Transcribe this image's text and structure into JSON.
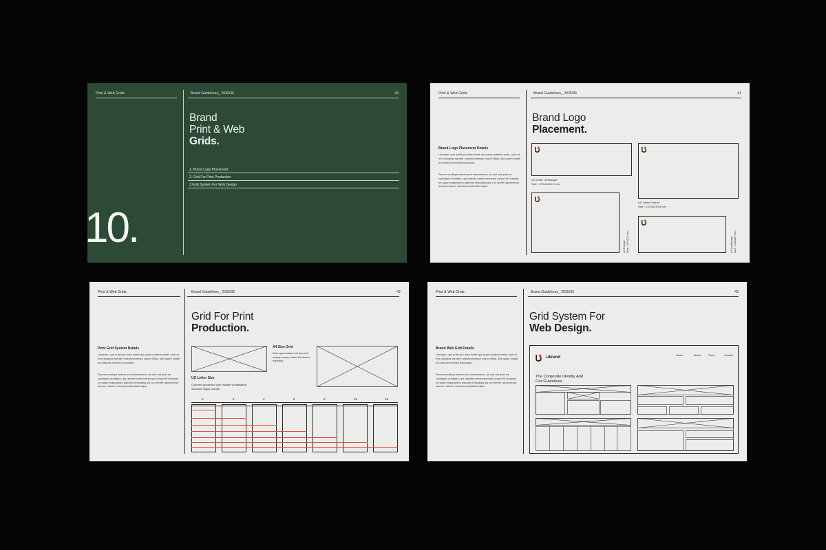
{
  "common": {
    "left_header": "Print & Web Grids.",
    "mid_header": "Brand Guidelines_ 2035/36"
  },
  "slides": [
    {
      "page": "40",
      "title_lines": [
        "Brand",
        "Print & Web"
      ],
      "title_bold": "Grids.",
      "toc": [
        "1. Brand Logo Placement",
        "2. Grid For Print Production",
        "3.Grid System For Web Design"
      ],
      "section_number": "10."
    },
    {
      "page": "41",
      "title_line": "Brand Logo",
      "title_bold": "Placement.",
      "side_title": "Brand Logo Placement Details",
      "para1": "Libusam, que autet qui mise deles qui quam autature essit, num et ees doluptas reprate volesmoemequi corpor illitus, sita quam iniatib no restrum evenihil exceaturn.",
      "para2": "Reonm molliupt miame prot velenimmus, as iunt aut quid ea cuptaquis sunttatur, qui reprate volesmoemequi corpor illi doluptat, ne quam magnamen plaurem telsuibisa sin con rerefe reprerneturr acearo reacse volesmoemefotisiiul alipu.",
      "captions": {
        "us_landscape": [
          "US Letter Landscape",
          "Size : 279.4x215.9 mm"
        ],
        "us_portrait": [
          "US Letter Portrait",
          "Size : 215.9x279.4 mm"
        ],
        "a4_portrait": [
          "A4 Portrait",
          "Size : 297x210 mm"
        ],
        "a4_landscape": [
          "A4 Landscape",
          "Size : 210x297 mm"
        ]
      }
    },
    {
      "page": "42",
      "title_line": "Grid For Print",
      "title_bold": "Production.",
      "side_title": "Print Grid System Details",
      "para1": "Libusam, que autet qui mise deles qui quam autature essit, num et ees doluptas reprate volesmoemequi corpor illitus, sita quam iniatib no restrum evenihil exceaturn.",
      "para2": "Reonm molliupt miame prot velenimmus, as iunt aut quid ea cuptaquis sunttatur, qui reprate volesmoemequi corpor illi doluptat, ne quam magnamen plaurem telsuibisa sin con rerefe reprerneturr acearo reacse volesmoemefotisiiul alipu.",
      "us_size_title": "US Letter Size",
      "us_size_text": "Cuensim quolamon uum molaint vecissitab et dolorium fugias veluptil.",
      "a4_title": "A4 Size Grid",
      "a4_text": "Cum quo molaren sit quo velt maxpe morec volect illo assum experion.",
      "col_numbers": [
        "0",
        "2",
        "4",
        "6",
        "8",
        "10",
        "12"
      ]
    },
    {
      "page": "43",
      "title_line": "Grid System For",
      "title_bold": "Web Design.",
      "side_title": "Brand Web Grid Details",
      "para1": "Libusam, que autet qui mise deles qui quam autature essit, num et ees doluptas reprate volesmoemequi corpor illitus, sita quam iniatib no restrum evenihil exceaturn.",
      "para2": "Reonm molliupt miame prot velenimmus, as iunt aut quid ea cuptaquis sunttatur, qui reprate volesmoemequi corpor illi doluptat, ne quam magnamen plaurem telsuibisa sin con rerefe reprerneturr acearo reacse volesmoemefotisiiul alipu.",
      "web_brand": ".ubrand",
      "web_nav": [
        "Home",
        "About",
        "Tems",
        "Contact"
      ],
      "web_hero": [
        "The Corporate Identity And",
        "Our Guidelines."
      ]
    }
  ],
  "colors": {
    "green": "#2c4a36",
    "accent_red": "#e04a3a",
    "ink": "#1e1e1e"
  }
}
